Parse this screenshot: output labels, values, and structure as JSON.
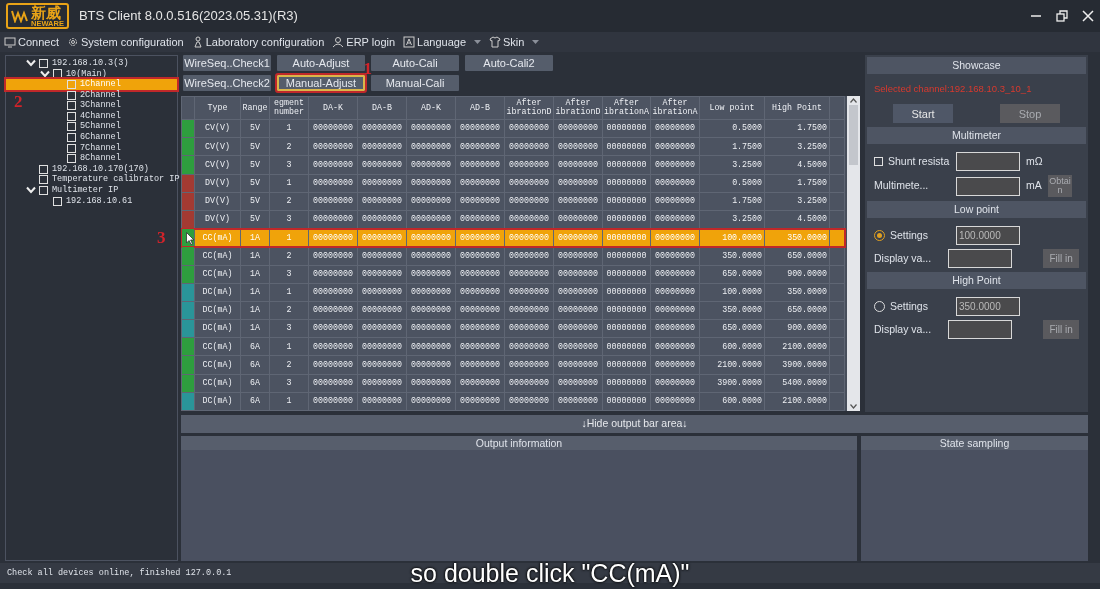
{
  "window": {
    "logo": {
      "name": "新威",
      "sub": "NEWARE"
    },
    "title": "BTS Client 8.0.0.516(2023.05.31)(R3)"
  },
  "menu": [
    {
      "label": "Connect",
      "kind": "monitor",
      "dropdown": false
    },
    {
      "label": "System configuration",
      "kind": "gear",
      "dropdown": false
    },
    {
      "label": "Laboratory configuration",
      "kind": "lab",
      "dropdown": false
    },
    {
      "label": "ERP login",
      "kind": "person",
      "dropdown": false
    },
    {
      "label": "Language",
      "kind": "letter",
      "dropdown": true
    },
    {
      "label": "Skin",
      "kind": "shirt",
      "dropdown": true
    }
  ],
  "tree": [
    {
      "label": "192.168.10.3(3)",
      "expanded": true,
      "checked": false,
      "selected": false,
      "children": [
        {
          "label": "10(Main)",
          "expanded": true,
          "checked": false,
          "selected": false,
          "children": [
            {
              "label": "1Channel",
              "checked": false,
              "selected": true,
              "annotation": "2"
            },
            {
              "label": "2Channel",
              "checked": false,
              "selected": false
            },
            {
              "label": "3Channel",
              "checked": false,
              "selected": false
            },
            {
              "label": "4Channel",
              "checked": false,
              "selected": false
            },
            {
              "label": "5Channel",
              "checked": false,
              "selected": false
            },
            {
              "label": "6Channel",
              "checked": false,
              "selected": false
            },
            {
              "label": "7Channel",
              "checked": false,
              "selected": false
            },
            {
              "label": "8Channel",
              "checked": false,
              "selected": false
            }
          ]
        }
      ]
    },
    {
      "label": "192.168.10.170(170)",
      "checked": false,
      "selected": false
    },
    {
      "label": "Temperature calibrator IP",
      "checked": false,
      "selected": false
    },
    {
      "label": "Multimeter IP",
      "expanded": true,
      "checked": false,
      "selected": false,
      "children": [
        {
          "label": "192.168.10.61",
          "checked": false,
          "selected": false
        }
      ]
    }
  ],
  "button_rows": [
    {
      "buttons": [
        {
          "label": "WireSeq..Check1",
          "selected": false
        },
        {
          "label": "Auto-Adjust",
          "selected": false
        },
        {
          "label": "Auto-Cali",
          "selected": false
        },
        {
          "label": "Auto-Cali2",
          "selected": false
        }
      ]
    },
    {
      "buttons": [
        {
          "label": "WireSeq..Check2",
          "selected": false
        },
        {
          "label": "Manual-Adjust",
          "selected": true,
          "annotation": "1"
        },
        {
          "label": "Manual-Cali",
          "selected": false
        }
      ]
    }
  ],
  "table": {
    "columns": [
      "Type",
      "Range",
      "egment number",
      "DA-K",
      "DA-B",
      "AD-K",
      "AD-B",
      "After ibrationD",
      "After ibrationD",
      "After ibrationA",
      "After ibrationA",
      "Low point",
      "High Point"
    ],
    "rows": [
      {
        "color": "#2e9e3e",
        "selected": false,
        "cells": [
          "CV(V)",
          "5V",
          "1",
          "00000000",
          "00000000",
          "00000000",
          "00000000",
          "00000000",
          "00000000",
          "00000000",
          "00000000",
          "0.5000",
          "1.7500"
        ]
      },
      {
        "color": "#2e9e3e",
        "selected": false,
        "cells": [
          "CV(V)",
          "5V",
          "2",
          "00000000",
          "00000000",
          "00000000",
          "00000000",
          "00000000",
          "00000000",
          "00000000",
          "00000000",
          "1.7500",
          "3.2500"
        ]
      },
      {
        "color": "#2e9e3e",
        "selected": false,
        "cells": [
          "CV(V)",
          "5V",
          "3",
          "00000000",
          "00000000",
          "00000000",
          "00000000",
          "00000000",
          "00000000",
          "00000000",
          "00000000",
          "3.2500",
          "4.5000"
        ]
      },
      {
        "color": "#a33a32",
        "selected": false,
        "cells": [
          "DV(V)",
          "5V",
          "1",
          "00000000",
          "00000000",
          "00000000",
          "00000000",
          "00000000",
          "00000000",
          "00000000",
          "00000000",
          "0.5000",
          "1.7500"
        ]
      },
      {
        "color": "#a33a32",
        "selected": false,
        "cells": [
          "DV(V)",
          "5V",
          "2",
          "00000000",
          "00000000",
          "00000000",
          "00000000",
          "00000000",
          "00000000",
          "00000000",
          "00000000",
          "1.7500",
          "3.2500"
        ]
      },
      {
        "color": "#a33a32",
        "selected": false,
        "cells": [
          "DV(V)",
          "5V",
          "3",
          "00000000",
          "00000000",
          "00000000",
          "00000000",
          "00000000",
          "00000000",
          "00000000",
          "00000000",
          "3.2500",
          "4.5000"
        ]
      },
      {
        "color": "#2e9e3e",
        "selected": true,
        "annotation": "3",
        "cells": [
          "CC(mA)",
          "1A",
          "1",
          "00000000",
          "00000000",
          "00000000",
          "00000000",
          "00000000",
          "00000000",
          "00000000",
          "00000000",
          "100.0000",
          "350.0000"
        ]
      },
      {
        "color": "#2e9e3e",
        "selected": false,
        "cells": [
          "CC(mA)",
          "1A",
          "2",
          "00000000",
          "00000000",
          "00000000",
          "00000000",
          "00000000",
          "00000000",
          "00000000",
          "00000000",
          "350.0000",
          "650.0000"
        ]
      },
      {
        "color": "#2e9e3e",
        "selected": false,
        "cells": [
          "CC(mA)",
          "1A",
          "3",
          "00000000",
          "00000000",
          "00000000",
          "00000000",
          "00000000",
          "00000000",
          "00000000",
          "00000000",
          "650.0000",
          "900.0000"
        ]
      },
      {
        "color": "#2a9599",
        "selected": false,
        "cells": [
          "DC(mA)",
          "1A",
          "1",
          "00000000",
          "00000000",
          "00000000",
          "00000000",
          "00000000",
          "00000000",
          "00000000",
          "00000000",
          "100.0000",
          "350.0000"
        ]
      },
      {
        "color": "#2a9599",
        "selected": false,
        "cells": [
          "DC(mA)",
          "1A",
          "2",
          "00000000",
          "00000000",
          "00000000",
          "00000000",
          "00000000",
          "00000000",
          "00000000",
          "00000000",
          "350.0000",
          "650.0000"
        ]
      },
      {
        "color": "#2a9599",
        "selected": false,
        "cells": [
          "DC(mA)",
          "1A",
          "3",
          "00000000",
          "00000000",
          "00000000",
          "00000000",
          "00000000",
          "00000000",
          "00000000",
          "00000000",
          "650.0000",
          "900.0000"
        ]
      },
      {
        "color": "#2e9e3e",
        "selected": false,
        "cells": [
          "CC(mA)",
          "6A",
          "1",
          "00000000",
          "00000000",
          "00000000",
          "00000000",
          "00000000",
          "00000000",
          "00000000",
          "00000000",
          "600.0000",
          "2100.0000"
        ]
      },
      {
        "color": "#2e9e3e",
        "selected": false,
        "cells": [
          "CC(mA)",
          "6A",
          "2",
          "00000000",
          "00000000",
          "00000000",
          "00000000",
          "00000000",
          "00000000",
          "00000000",
          "00000000",
          "2100.0000",
          "3900.0000"
        ]
      },
      {
        "color": "#2e9e3e",
        "selected": false,
        "cells": [
          "CC(mA)",
          "6A",
          "3",
          "00000000",
          "00000000",
          "00000000",
          "00000000",
          "00000000",
          "00000000",
          "00000000",
          "00000000",
          "3900.0000",
          "5400.0000"
        ]
      },
      {
        "color": "#2a9599",
        "selected": false,
        "cells": [
          "DC(mA)",
          "6A",
          "1",
          "00000000",
          "00000000",
          "00000000",
          "00000000",
          "00000000",
          "00000000",
          "00000000",
          "00000000",
          "600.0000",
          "2100.0000"
        ]
      }
    ]
  },
  "side_panel": [
    {
      "title": "Showcase",
      "rows": [
        {
          "kind": "notice",
          "text": "Selected channel:192.168.10.3_10_1"
        },
        {
          "kind": "buttons",
          "buttons": [
            {
              "label": "Start",
              "disabled": false
            },
            {
              "label": "Stop",
              "disabled": true
            }
          ]
        }
      ]
    },
    {
      "title": "Multimeter",
      "rows": [
        {
          "kind": "checkbox_field",
          "checked": false,
          "label": "Shunt resista",
          "unit": "mΩ"
        },
        {
          "kind": "field",
          "label": "Multimete...",
          "unit": "mA",
          "button": {
            "label": "Obtain",
            "disabled": true
          }
        }
      ]
    },
    {
      "title": "Low point",
      "rows": [
        {
          "kind": "radio_field",
          "selected": true,
          "label": "Settings",
          "value": "100.0000"
        },
        {
          "kind": "field",
          "label": "Display va...",
          "button": {
            "label": "Fill in",
            "disabled": true
          }
        }
      ]
    },
    {
      "title": "High Point",
      "rows": [
        {
          "kind": "radio_field",
          "selected": false,
          "label": "Settings",
          "value": "350.0000"
        },
        {
          "kind": "field",
          "label": "Display va...",
          "button": {
            "label": "Fill in",
            "disabled": true
          }
        }
      ]
    }
  ],
  "hide_bar": "↓Hide output bar area↓",
  "output_panels": [
    {
      "title": "Output information"
    },
    {
      "title": "State sampling"
    }
  ],
  "status_bar": "Check all devices online, finished 127.0.0.1",
  "caption": "so double click \"CC(mA)\""
}
